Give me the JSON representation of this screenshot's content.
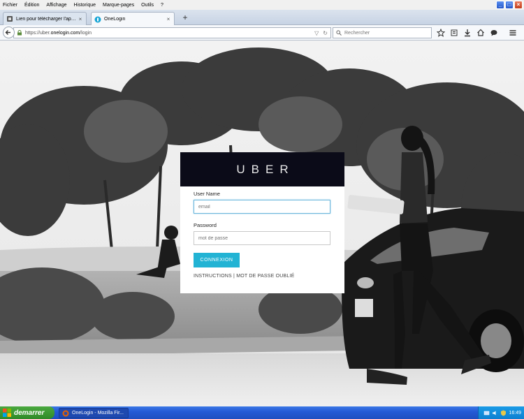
{
  "menu": [
    "Fichier",
    "Édition",
    "Affichage",
    "Historique",
    "Marque-pages",
    "Outils",
    "?"
  ],
  "tabs": [
    {
      "title": "Lien pour télécharger l'applica...",
      "active": false
    },
    {
      "title": "OneLogin",
      "active": true
    }
  ],
  "nav": {
    "url_prefix": "https://uber.",
    "url_domain": "onelogin.com",
    "url_path": "/login",
    "search_placeholder": "Rechercher"
  },
  "login": {
    "logo": "UBER",
    "username_label": "User Name",
    "username_placeholder": "email",
    "password_label": "Password",
    "password_placeholder": "mot de passe",
    "submit_label": "CONNEXION",
    "links_text": "INSTRUCTIONS | MOT DE PASSE OUBLIÉ"
  },
  "taskbar": {
    "start_label": "demarrer",
    "window_title": "OneLogin - Mozilla Fir...",
    "clock": "16:49"
  },
  "colors": {
    "accent": "#22b3d4",
    "header": "#0b0b18",
    "taskbar": "#245ad6",
    "start": "#2f8a28"
  }
}
